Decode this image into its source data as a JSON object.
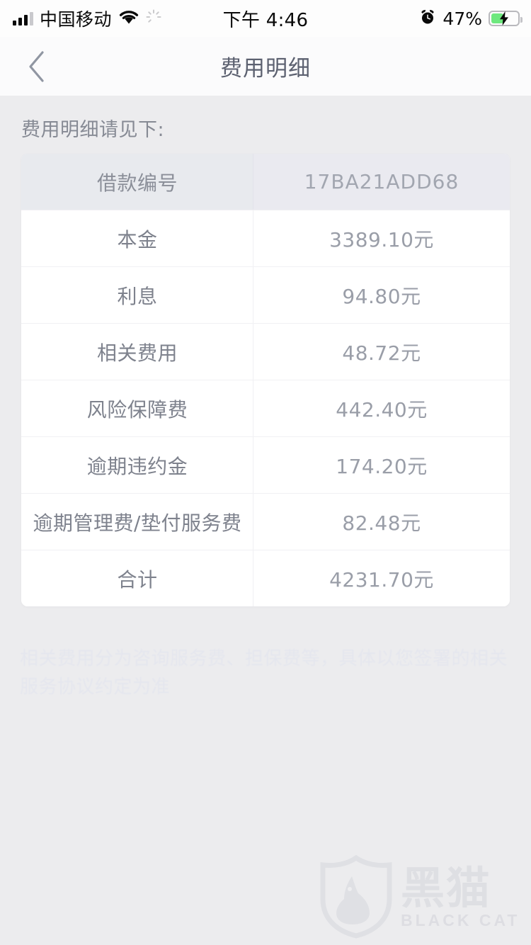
{
  "status_bar": {
    "carrier": "中国移动",
    "signal_icon": "signal-bars-icon",
    "wifi_icon": "wifi-icon",
    "spinner_icon": "activity-spinner-icon",
    "time": "下午 4:46",
    "alarm_icon": "alarm-clock-icon",
    "battery_percent": "47%",
    "battery_icon": "battery-charging-icon",
    "battery_level": 47,
    "battery_color": "#6ee87e"
  },
  "nav_bar": {
    "back_icon": "chevron-left-icon",
    "title": "费用明细"
  },
  "page": {
    "intro": "费用明细请见下:",
    "footnote": "相关费用分为咨询服务费、担保费等，具体以您签署的相关服务协议约定为准"
  },
  "fee_table": {
    "header": {
      "label": "借款编号",
      "value": "17BA21ADD68"
    },
    "rows": [
      {
        "label": "本金",
        "value": "3389.10元"
      },
      {
        "label": "利息",
        "value": "94.80元"
      },
      {
        "label": "相关费用",
        "value": "48.72元"
      },
      {
        "label": "风险保障费",
        "value": "442.40元"
      },
      {
        "label": "逾期违约金",
        "value": "174.20元"
      },
      {
        "label": "逾期管理费/垫付服务费",
        "value": "82.48元"
      },
      {
        "label": "合计",
        "value": "4231.70元"
      }
    ]
  },
  "watermark": {
    "shield_icon": "black-cat-shield-logo",
    "cn_text": "黑猫",
    "en_text": "BLACK CAT"
  },
  "colors": {
    "page_background": "#ececee",
    "card_background": "#ffffff",
    "table_header_background": "#e9eaef",
    "label_text": "#7e828d",
    "value_text": "#9a9ea8",
    "nav_title": "#5c6170"
  }
}
